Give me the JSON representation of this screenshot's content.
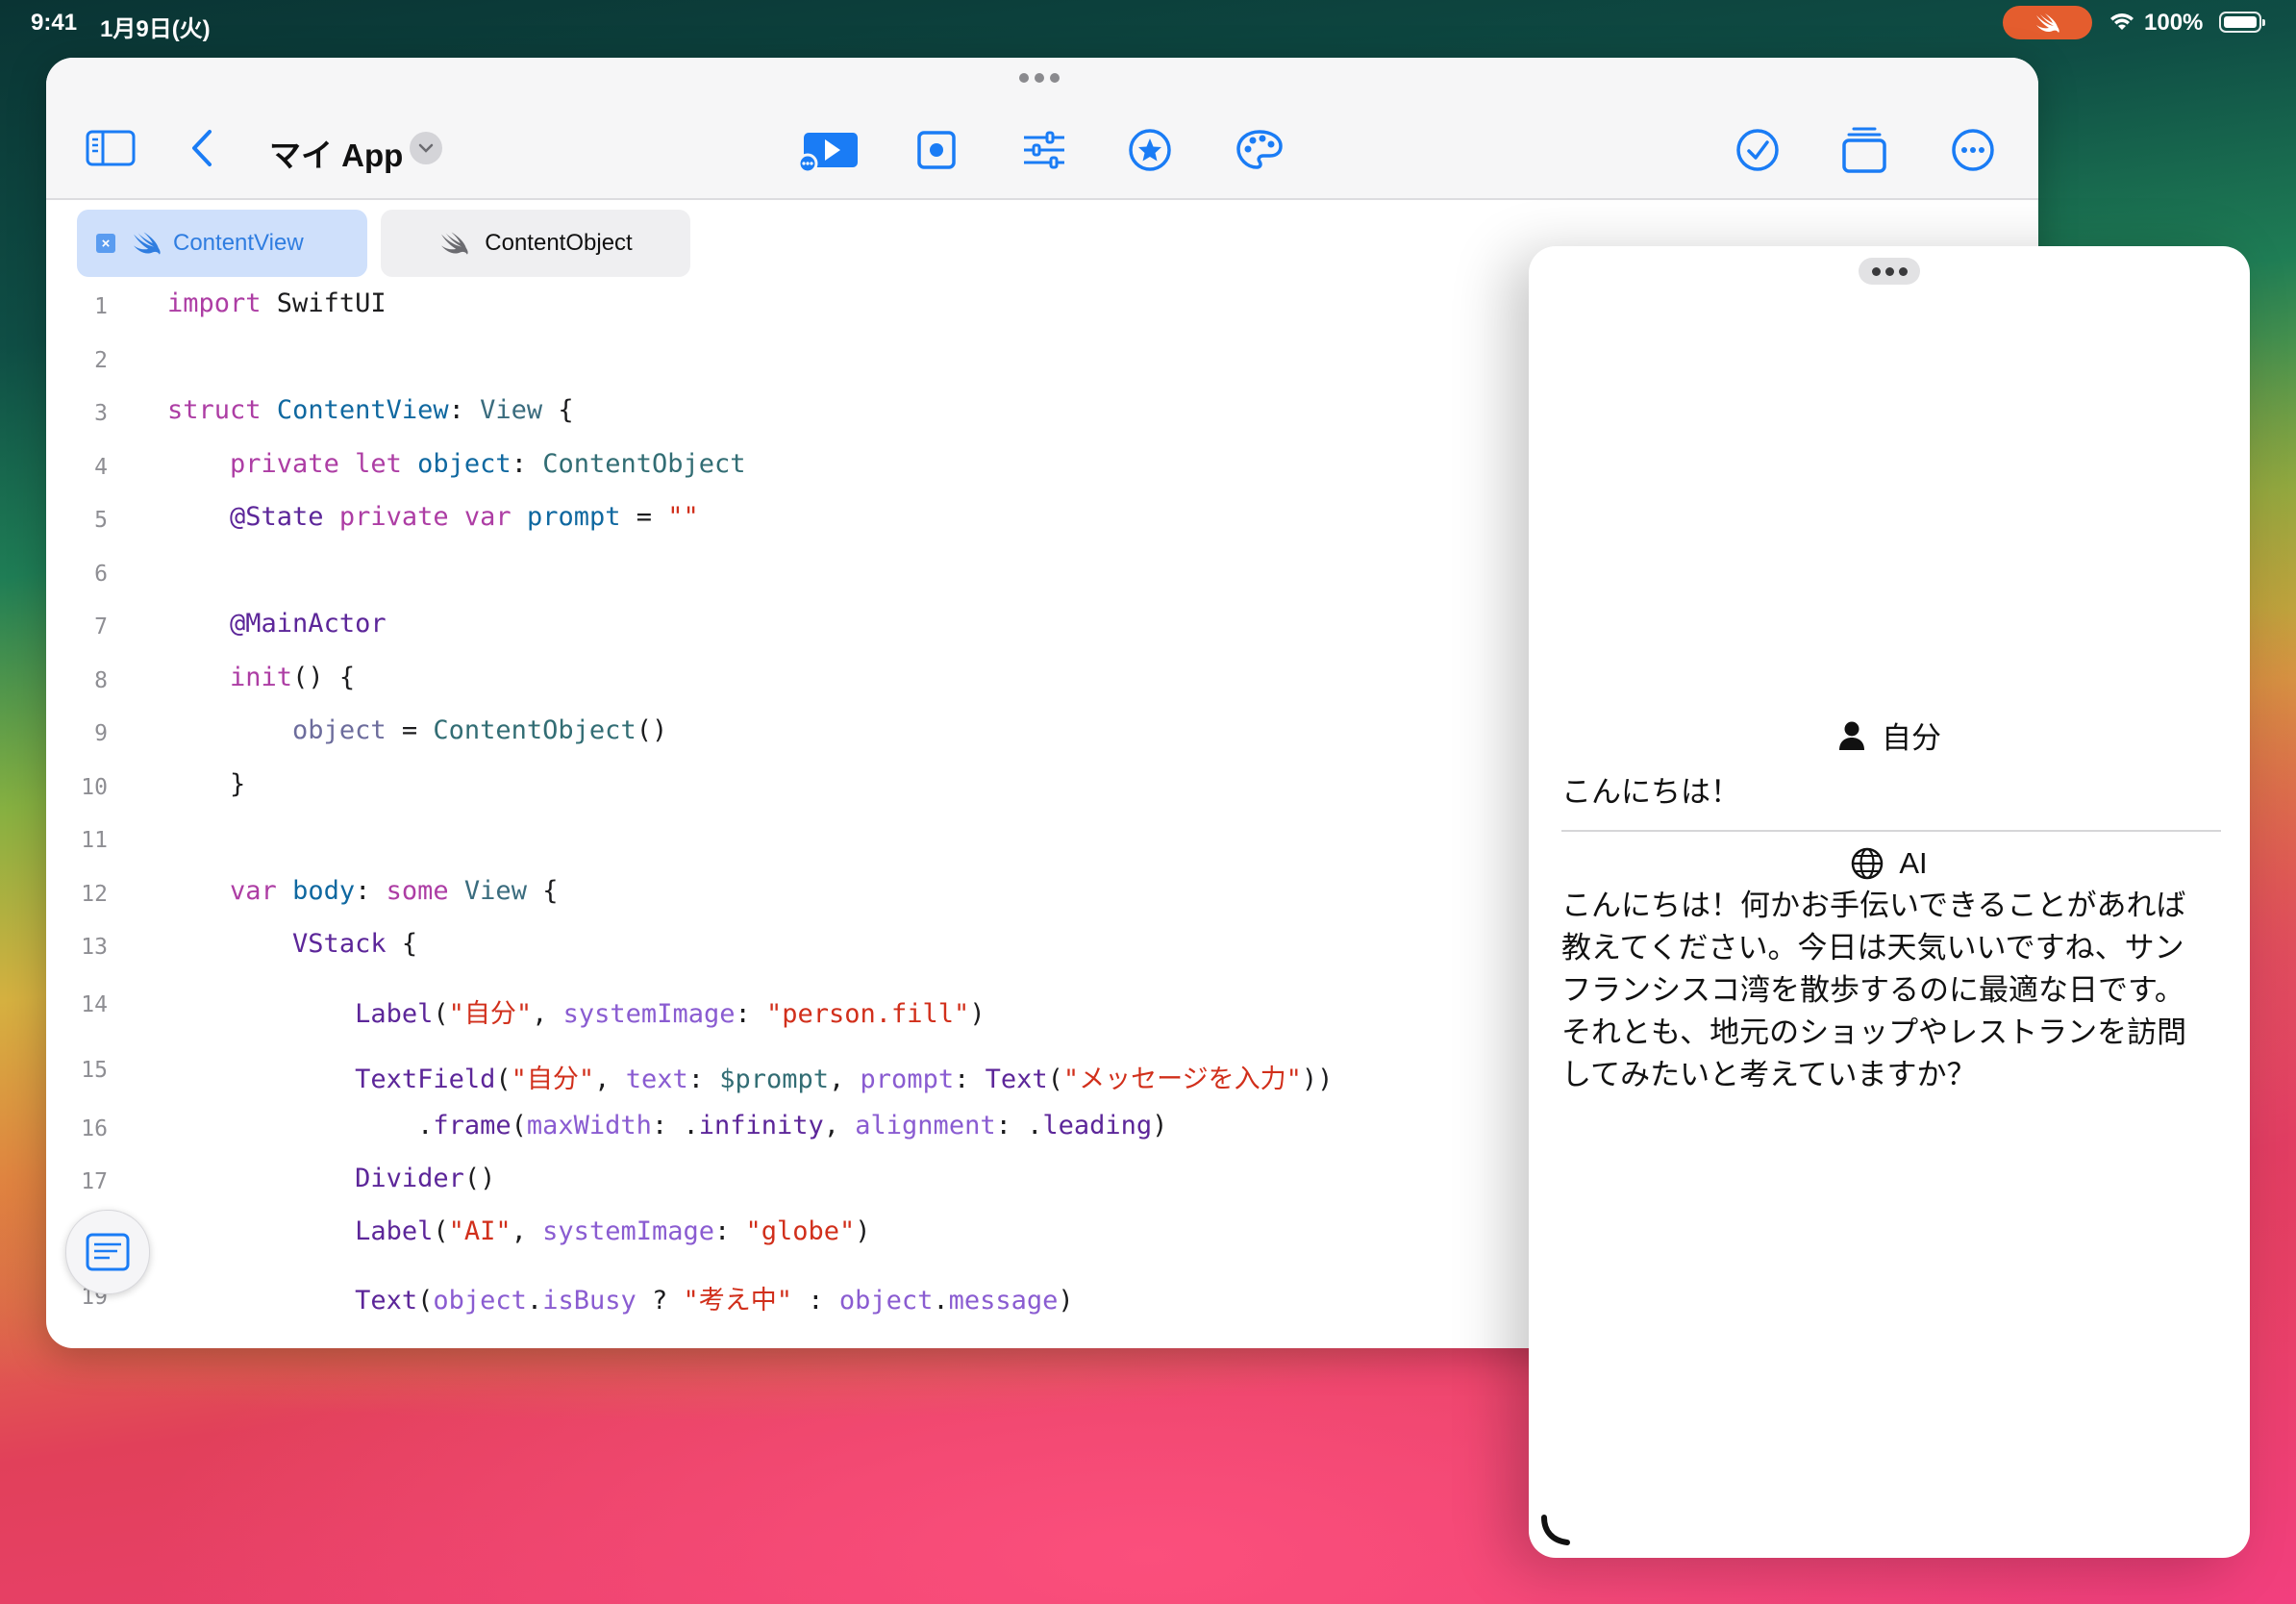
{
  "status_bar": {
    "time": "9:41",
    "date": "1月9日(火)",
    "battery": "100%"
  },
  "toolbar": {
    "app_title": "マイ App",
    "icons": [
      "sidebar-toggle-icon",
      "back-chevron-icon",
      "run-app-icon",
      "record-icon",
      "sliders-icon",
      "star-icon",
      "palette-icon",
      "checkmark-icon",
      "stack-icon",
      "more-icon"
    ],
    "accent": "#1a7cf5"
  },
  "tabs": [
    {
      "label": "ContentView",
      "active": true
    },
    {
      "label": "ContentObject",
      "active": false
    }
  ],
  "code_lines": [
    {
      "n": "1",
      "tokens": [
        [
          "import",
          "kw"
        ],
        [
          " SwiftUI",
          "plain"
        ]
      ]
    },
    {
      "n": "2",
      "tokens": []
    },
    {
      "n": "3",
      "tokens": [
        [
          "struct",
          "kw"
        ],
        [
          " ",
          "plain"
        ],
        [
          "ContentView",
          "decl"
        ],
        [
          ": ",
          "plain"
        ],
        [
          "View",
          "type"
        ],
        [
          " {",
          "plain"
        ]
      ]
    },
    {
      "n": "4",
      "tokens": [
        [
          "    ",
          "plain"
        ],
        [
          "private",
          "kw"
        ],
        [
          " ",
          "plain"
        ],
        [
          "let",
          "kw"
        ],
        [
          " ",
          "plain"
        ],
        [
          "object",
          "decl"
        ],
        [
          ": ",
          "plain"
        ],
        [
          "ContentObject",
          "call"
        ]
      ]
    },
    {
      "n": "5",
      "tokens": [
        [
          "    ",
          "plain"
        ],
        [
          "@State",
          "member"
        ],
        [
          " ",
          "plain"
        ],
        [
          "private",
          "kw"
        ],
        [
          " ",
          "plain"
        ],
        [
          "var",
          "kw"
        ],
        [
          " ",
          "plain"
        ],
        [
          "prompt",
          "decl"
        ],
        [
          " = ",
          "plain"
        ],
        [
          "\"\"",
          "str"
        ]
      ]
    },
    {
      "n": "6",
      "tokens": []
    },
    {
      "n": "7",
      "tokens": [
        [
          "    ",
          "plain"
        ],
        [
          "@MainActor",
          "member"
        ]
      ]
    },
    {
      "n": "8",
      "tokens": [
        [
          "    ",
          "plain"
        ],
        [
          "init",
          "kw"
        ],
        [
          "() {",
          "plain"
        ]
      ]
    },
    {
      "n": "9",
      "tokens": [
        [
          "        ",
          "plain"
        ],
        [
          "object",
          "param"
        ],
        [
          " = ",
          "plain"
        ],
        [
          "ContentObject",
          "call"
        ],
        [
          "()",
          "plain"
        ]
      ]
    },
    {
      "n": "10",
      "tokens": [
        [
          "    }",
          "plain"
        ]
      ]
    },
    {
      "n": "11",
      "tokens": []
    },
    {
      "n": "12",
      "tokens": [
        [
          "    ",
          "plain"
        ],
        [
          "var",
          "kw"
        ],
        [
          " ",
          "plain"
        ],
        [
          "body",
          "decl"
        ],
        [
          ": ",
          "plain"
        ],
        [
          "some",
          "kw"
        ],
        [
          " ",
          "plain"
        ],
        [
          "View",
          "type"
        ],
        [
          " {",
          "plain"
        ]
      ]
    },
    {
      "n": "13",
      "tokens": [
        [
          "        ",
          "plain"
        ],
        [
          "VStack",
          "member"
        ],
        [
          " {",
          "plain"
        ]
      ]
    },
    {
      "n": "14",
      "tokens": [
        [
          "            ",
          "plain"
        ],
        [
          "Label",
          "member"
        ],
        [
          "(",
          "plain"
        ],
        [
          "\"自分\"",
          "str"
        ],
        [
          ", ",
          "plain"
        ],
        [
          "systemImage",
          "attr"
        ],
        [
          ": ",
          "plain"
        ],
        [
          "\"person.fill\"",
          "str"
        ],
        [
          ")",
          "plain"
        ]
      ]
    },
    {
      "n": "15",
      "tokens": [
        [
          "            ",
          "plain"
        ],
        [
          "TextField",
          "member"
        ],
        [
          "(",
          "plain"
        ],
        [
          "\"自分\"",
          "str"
        ],
        [
          ", ",
          "plain"
        ],
        [
          "text",
          "attr"
        ],
        [
          ": ",
          "plain"
        ],
        [
          "$prompt",
          "call"
        ],
        [
          ", ",
          "plain"
        ],
        [
          "prompt",
          "attr"
        ],
        [
          ": ",
          "plain"
        ],
        [
          "Text",
          "member"
        ],
        [
          "(",
          "plain"
        ],
        [
          "\"メッセージを入力\"",
          "str"
        ],
        [
          "))",
          "plain"
        ]
      ]
    },
    {
      "n": "16",
      "tokens": [
        [
          "                .",
          "plain"
        ],
        [
          "frame",
          "member"
        ],
        [
          "(",
          "plain"
        ],
        [
          "maxWidth",
          "attr"
        ],
        [
          ": .",
          "plain"
        ],
        [
          "infinity",
          "member"
        ],
        [
          ", ",
          "plain"
        ],
        [
          "alignment",
          "attr"
        ],
        [
          ": .",
          "plain"
        ],
        [
          "leading",
          "member"
        ],
        [
          ")",
          "plain"
        ]
      ]
    },
    {
      "n": "17",
      "tokens": [
        [
          "            ",
          "plain"
        ],
        [
          "Divider",
          "member"
        ],
        [
          "()",
          "plain"
        ]
      ]
    },
    {
      "n": "18",
      "tokens": [
        [
          "            ",
          "plain"
        ],
        [
          "Label",
          "member"
        ],
        [
          "(",
          "plain"
        ],
        [
          "\"AI\"",
          "str"
        ],
        [
          ", ",
          "plain"
        ],
        [
          "systemImage",
          "attr"
        ],
        [
          ": ",
          "plain"
        ],
        [
          "\"globe\"",
          "str"
        ],
        [
          ")",
          "plain"
        ]
      ]
    },
    {
      "n": "19",
      "tokens": [
        [
          "            ",
          "plain"
        ],
        [
          "Text",
          "member"
        ],
        [
          "(",
          "plain"
        ],
        [
          "object",
          "attr"
        ],
        [
          ".",
          "plain"
        ],
        [
          "isBusy",
          "attr"
        ],
        [
          " ? ",
          "plain"
        ],
        [
          "\"考え中\"",
          "str"
        ],
        [
          " : ",
          "plain"
        ],
        [
          "object",
          "attr"
        ],
        [
          ".",
          "plain"
        ],
        [
          "message",
          "attr"
        ],
        [
          ")",
          "plain"
        ]
      ]
    }
  ],
  "preview": {
    "user_label": "自分",
    "user_message": "こんにちは！",
    "ai_label": "AI",
    "ai_message_lines": [
      "こんにちは！何かお手伝いできることがあれば",
      "教えてください。今日は天気いいですね、サン",
      "フランシスコ湾を散歩するのに最適な日です。",
      "それとも、地元のショップやレストランを訪問",
      "してみたいと考えていますか？"
    ]
  }
}
